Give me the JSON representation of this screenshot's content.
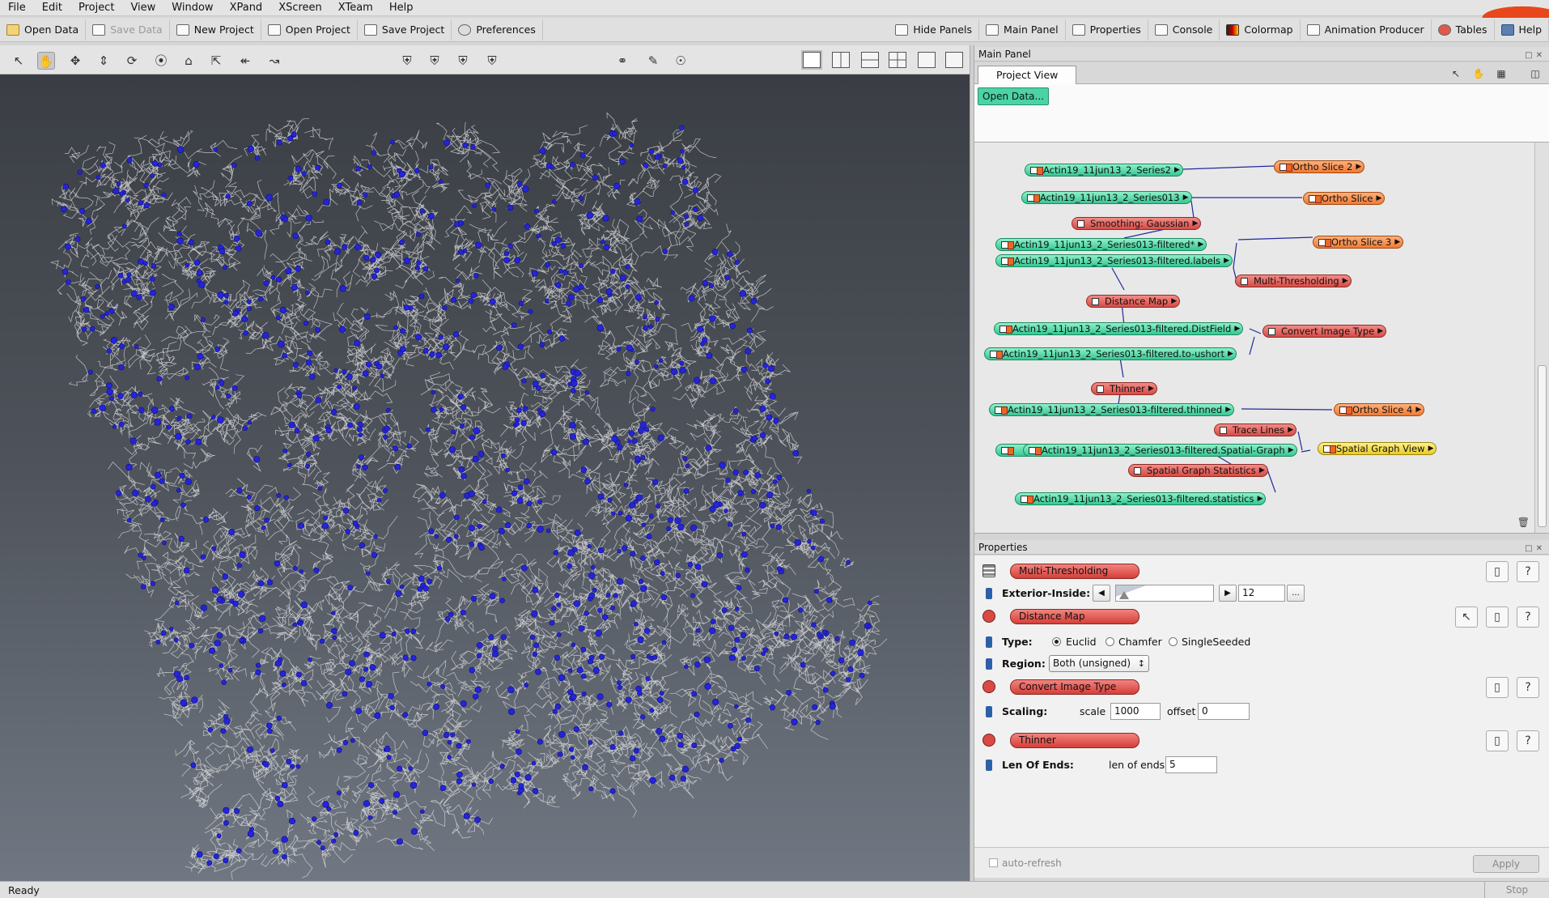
{
  "menubar": {
    "items": [
      {
        "label": "File"
      },
      {
        "label": "Edit"
      },
      {
        "label": "Project"
      },
      {
        "label": "View"
      },
      {
        "label": "Window"
      },
      {
        "label": "XPand"
      },
      {
        "label": "XScreen"
      },
      {
        "label": "XTeam"
      },
      {
        "label": "Help"
      }
    ]
  },
  "toolbar": {
    "left": [
      {
        "label": "Open Data",
        "icon": "folder-icon",
        "enabled": true
      },
      {
        "label": "Save Data",
        "icon": "save-icon",
        "enabled": false
      },
      {
        "label": "New Project",
        "icon": "new-project-icon",
        "enabled": true
      },
      {
        "label": "Open Project",
        "icon": "open-project-icon",
        "enabled": true
      },
      {
        "label": "Save Project",
        "icon": "save-project-icon",
        "enabled": true
      },
      {
        "label": "Preferences",
        "icon": "preferences-icon",
        "enabled": true
      }
    ],
    "right": [
      {
        "label": "Hide Panels",
        "icon": "hide-panels-icon"
      },
      {
        "label": "Main Panel",
        "icon": "main-panel-icon"
      },
      {
        "label": "Properties",
        "icon": "properties-icon"
      },
      {
        "label": "Console",
        "icon": "console-icon"
      },
      {
        "label": "Colormap",
        "icon": "colormap-icon"
      },
      {
        "label": "Animation Producer",
        "icon": "animation-icon"
      },
      {
        "label": "Tables",
        "icon": "tables-icon"
      },
      {
        "label": "Help",
        "icon": "help-icon"
      }
    ]
  },
  "main_panel": {
    "title": "Main Panel",
    "tab": "Project View",
    "open_data_button": "Open Data...",
    "nodes": [
      {
        "id": "n1",
        "label": "Actin19_11jun13_2_Series2",
        "kind": "data"
      },
      {
        "id": "n2",
        "label": "Ortho Slice 2",
        "kind": "display"
      },
      {
        "id": "n3",
        "label": "Actin19_11jun13_2_Series013",
        "kind": "data"
      },
      {
        "id": "n4",
        "label": "Ortho Slice",
        "kind": "display"
      },
      {
        "id": "n5",
        "label": "Smoothing: Gaussian",
        "kind": "compute"
      },
      {
        "id": "n6",
        "label": "Actin19_11jun13_2_Series013-filtered*",
        "kind": "data"
      },
      {
        "id": "n7",
        "label": "Ortho Slice 3",
        "kind": "display"
      },
      {
        "id": "n8",
        "label": "Actin19_11jun13_2_Series013-filtered.labels",
        "kind": "data"
      },
      {
        "id": "n9",
        "label": "Multi-Thresholding",
        "kind": "compute"
      },
      {
        "id": "n10",
        "label": "Distance Map",
        "kind": "compute"
      },
      {
        "id": "n11",
        "label": "Actin19_11jun13_2_Series013-filtered.DistField",
        "kind": "data"
      },
      {
        "id": "n12",
        "label": "Convert Image Type",
        "kind": "compute"
      },
      {
        "id": "n13",
        "label": "Actin19_11jun13_2_Series013-filtered.to-ushort",
        "kind": "data"
      },
      {
        "id": "n14",
        "label": "Thinner",
        "kind": "compute"
      },
      {
        "id": "n15",
        "label": "Actin19_11jun13_2_Series013-filtered.thinned",
        "kind": "data"
      },
      {
        "id": "n16",
        "label": "Ortho Slice 4",
        "kind": "display"
      },
      {
        "id": "n17",
        "label": "Trace Lines",
        "kind": "compute"
      },
      {
        "id": "n18",
        "label": "Actin19_11jun13_2_Series013-filtered.Spatial-Graph",
        "kind": "data"
      },
      {
        "id": "n19",
        "label": "Spatial Graph View",
        "kind": "display-y"
      },
      {
        "id": "n20",
        "label": "Spatial Graph Statistics",
        "kind": "compute"
      },
      {
        "id": "n21",
        "label": "Actin19_11jun13_2_Series013-filtered.statistics",
        "kind": "data"
      }
    ]
  },
  "properties": {
    "title": "Properties",
    "modules": {
      "multi_thresholding": {
        "label": "Multi-Thresholding",
        "port_label": "Exterior-Inside:",
        "value": "12",
        "more": "..."
      },
      "distance_map": {
        "label": "Distance Map",
        "type_label": "Type:",
        "type_options": [
          "Euclid",
          "Chamfer",
          "SingleSeeded"
        ],
        "type_selected": "Euclid",
        "region_label": "Region:",
        "region_value": "Both (unsigned)"
      },
      "convert_image_type": {
        "label": "Convert Image Type",
        "port_label": "Scaling:",
        "scale_label": "scale",
        "scale_value": "1000",
        "offset_label": "offset",
        "offset_value": "0"
      },
      "thinner": {
        "label": "Thinner",
        "port_label": "Len Of Ends:",
        "len_label": "len of ends",
        "len_value": "5"
      }
    },
    "auto_refresh_label": "auto-refresh",
    "auto_refresh_checked": false,
    "apply_label": "Apply",
    "help_symbol": "?"
  },
  "status": {
    "text": "Ready",
    "stop_label": "Stop"
  },
  "colors": {
    "data_node": "#35c794",
    "compute_node": "#d74c46",
    "display_node": "#f07a34",
    "viewer_bg_top": "#3a3e44",
    "network_points": "#2424d8",
    "network_lines": "#e8e8e8"
  }
}
